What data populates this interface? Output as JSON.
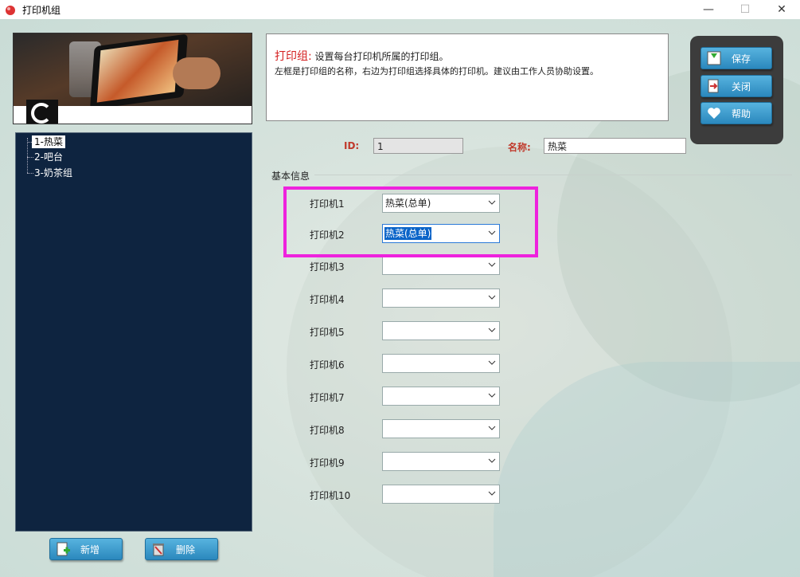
{
  "window": {
    "title": "打印机组",
    "minimize": "—",
    "maximize": "☐",
    "close": "✕"
  },
  "tree": {
    "items": [
      {
        "label": "1-热菜",
        "selected": true
      },
      {
        "label": "2-吧台",
        "selected": false
      },
      {
        "label": "3-奶茶组",
        "selected": false
      }
    ]
  },
  "left_buttons": {
    "add": "新增",
    "delete": "删除"
  },
  "info": {
    "heading": "打印组:",
    "line1": "设置每台打印机所属的打印组。",
    "line2": "左框是打印组的名称，右边为打印组选择具体的打印机。建议由工作人员协助设置。"
  },
  "actions": {
    "save": "保存",
    "close": "关闭",
    "help": "帮助"
  },
  "form": {
    "id_label": "ID:",
    "id_value": "1",
    "name_label": "名称:",
    "name_value": "热菜",
    "group_title": "基本信息"
  },
  "printers": [
    {
      "label": "打印机1",
      "value": "热菜(总单)"
    },
    {
      "label": "打印机2",
      "value": "热菜(总单)"
    },
    {
      "label": "打印机3",
      "value": ""
    },
    {
      "label": "打印机4",
      "value": ""
    },
    {
      "label": "打印机5",
      "value": ""
    },
    {
      "label": "打印机6",
      "value": ""
    },
    {
      "label": "打印机7",
      "value": ""
    },
    {
      "label": "打印机8",
      "value": ""
    },
    {
      "label": "打印机9",
      "value": ""
    },
    {
      "label": "打印机10",
      "value": ""
    }
  ],
  "colors": {
    "accent": "#2b88bd",
    "tree_bg": "#0e2440",
    "highlight": "#ee22dd",
    "red": "#d42020"
  }
}
